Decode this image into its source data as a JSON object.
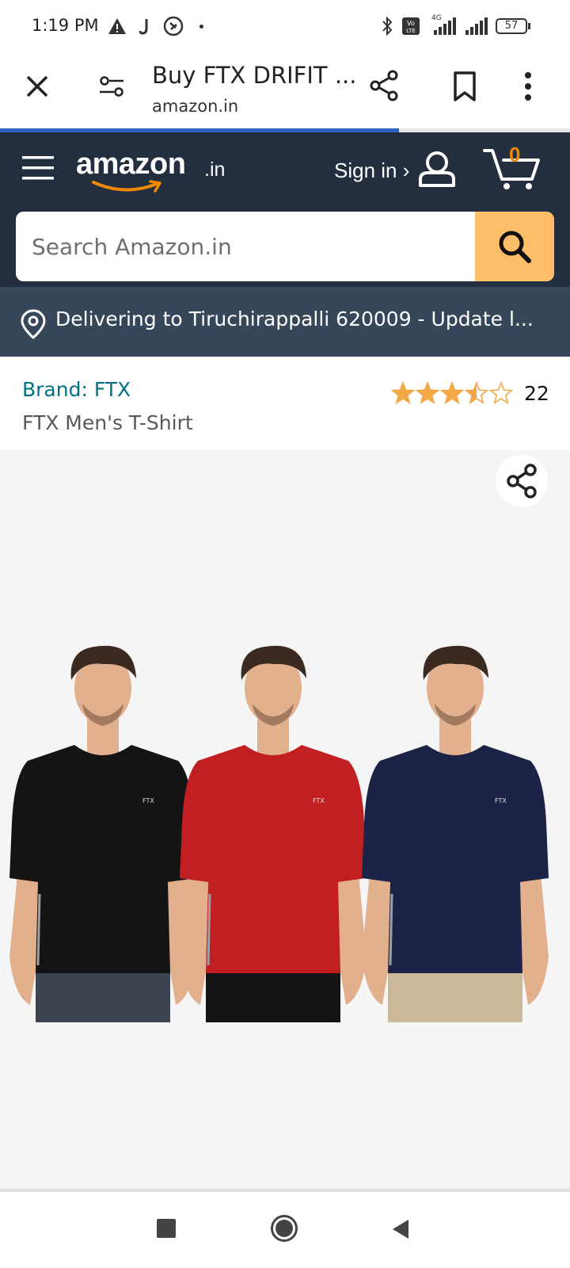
{
  "status_bar": {
    "time": "1:19 PM",
    "battery": "57",
    "network": "4G"
  },
  "tab": {
    "title": "Buy FTX DRIFIT ...",
    "domain": "amazon.in",
    "load_progress": 0.7
  },
  "header": {
    "logo_text": "amazon",
    "logo_suffix": ".in",
    "sign_in": "Sign in ›",
    "cart_count": "0"
  },
  "search": {
    "placeholder": "Search Amazon.in"
  },
  "delivery": {
    "text": "Delivering to Tiruchirappalli 620009 - Update l..."
  },
  "product": {
    "brand": "Brand: FTX",
    "name": "FTX Men's T-Shirt",
    "rating": 3.5,
    "rating_count": "22",
    "shirt_logo": "FTX",
    "images": [
      {
        "shirt_color": "#141414",
        "shorts_color": "#3d4350"
      },
      {
        "shirt_color": "#c21f22",
        "shorts_color": "#151515"
      },
      {
        "shirt_color": "#1c2346",
        "shorts_color": "#c9b89a"
      }
    ]
  },
  "colors": {
    "header_bg": "#232f3e",
    "delivery_bg": "#37475a",
    "search_button": "#febd69",
    "cart_accent": "#f08804",
    "star": "#f3a847",
    "link": "#007185",
    "progress": "#2f63c8"
  },
  "icons": {
    "close": "close-icon",
    "tab_options": "tune-icon",
    "share": "share-icon",
    "bookmark": "bookmark-icon",
    "menu": "more-vert-icon",
    "hamburger": "hamburger-icon",
    "account": "user-icon",
    "cart": "cart-icon",
    "search": "search-icon",
    "location": "location-pin-icon"
  }
}
